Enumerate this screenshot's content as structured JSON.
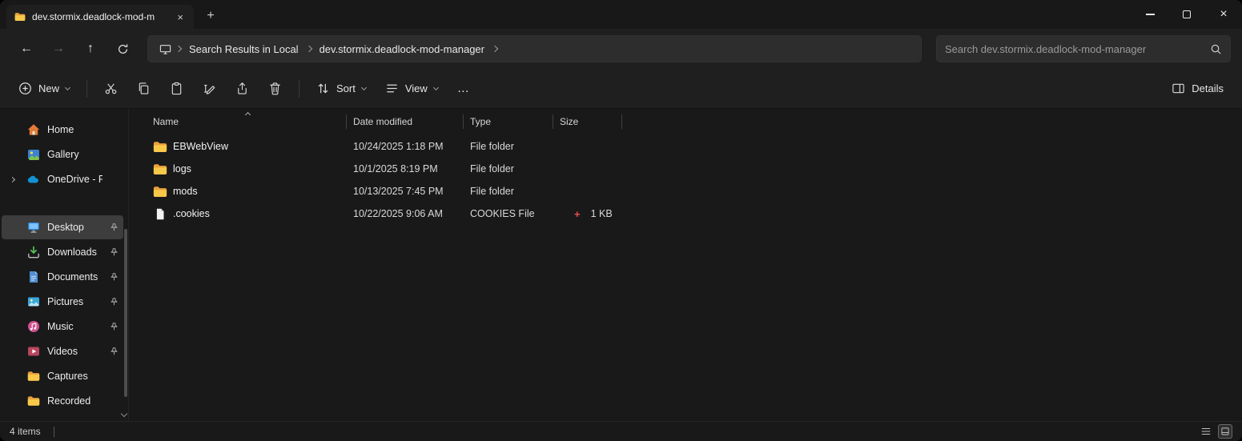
{
  "window": {
    "tab": {
      "title": "dev.stormix.deadlock-mod-m",
      "close_glyph": "×"
    },
    "new_tab_glyph": "+",
    "controls": {
      "close_glyph": "×"
    }
  },
  "navigation": {
    "back_glyph": "←",
    "forward_glyph": "→",
    "up_glyph": "↑",
    "breadcrumb": [
      "Search Results in Local",
      "dev.stormix.deadlock-mod-manager"
    ],
    "search_placeholder": "Search dev.stormix.deadlock-mod-manager"
  },
  "toolbar": {
    "new_label": "New",
    "sort_label": "Sort",
    "view_label": "View",
    "more_label": "…",
    "details_label": "Details"
  },
  "sidebar": {
    "items": [
      {
        "label": "Home",
        "icon": "home"
      },
      {
        "label": "Gallery",
        "icon": "gallery"
      },
      {
        "label": "OneDrive - Pers",
        "icon": "onedrive",
        "expandable": true
      },
      {
        "label": "Desktop",
        "icon": "desktop",
        "pinned": true,
        "selected": true,
        "gap_before": true
      },
      {
        "label": "Downloads",
        "icon": "downloads",
        "pinned": true
      },
      {
        "label": "Documents",
        "icon": "documents",
        "pinned": true
      },
      {
        "label": "Pictures",
        "icon": "pictures",
        "pinned": true
      },
      {
        "label": "Music",
        "icon": "music",
        "pinned": true
      },
      {
        "label": "Videos",
        "icon": "videos",
        "pinned": true
      },
      {
        "label": "Captures",
        "icon": "folder"
      },
      {
        "label": "Recorded",
        "icon": "folder"
      }
    ]
  },
  "file_list": {
    "columns": [
      "Name",
      "Date modified",
      "Type",
      "Size"
    ],
    "rows": [
      {
        "name": "EBWebView",
        "date": "10/24/2025 1:18 PM",
        "type": "File folder",
        "size": "",
        "badge": "",
        "icon": "folder"
      },
      {
        "name": "logs",
        "date": "10/1/2025 8:19 PM",
        "type": "File folder",
        "size": "",
        "badge": "",
        "icon": "folder"
      },
      {
        "name": "mods",
        "date": "10/13/2025 7:45 PM",
        "type": "File folder",
        "size": "",
        "badge": "",
        "icon": "folder"
      },
      {
        "name": ".cookies",
        "date": "10/22/2025 9:06 AM",
        "type": "COOKIES File",
        "size": "1 KB",
        "badge": "+",
        "icon": "file"
      }
    ]
  },
  "status_bar": {
    "items_count": "4 items"
  },
  "colors": {
    "folder_yellow": "#f8c84a",
    "badge_plus_red": "#ee4b4e",
    "onedrive_blue": "#1291d3"
  }
}
